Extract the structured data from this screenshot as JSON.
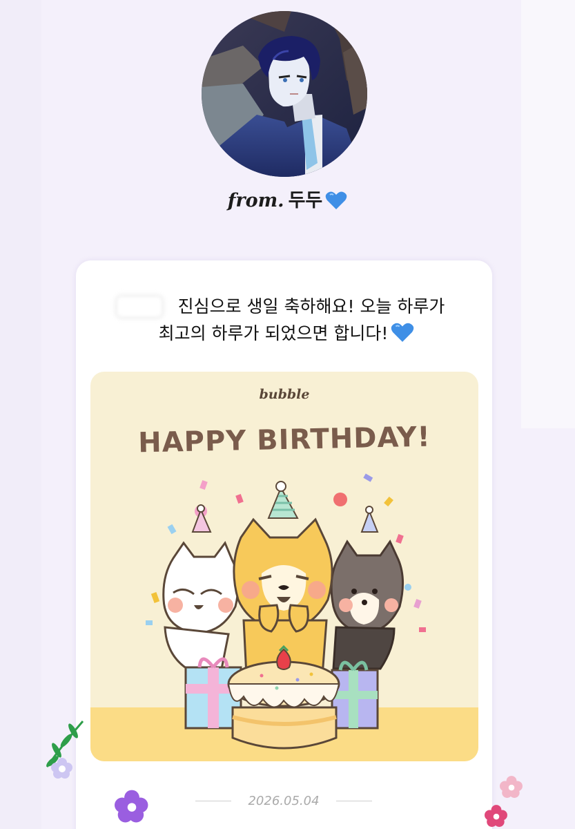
{
  "profile": {
    "from_prefix": "from.",
    "name": "두두",
    "heart_icon": "blue-heart-icon",
    "heart_color": "#3f8fe6"
  },
  "message": {
    "line1": "진심으로 생일 축하해요! 오늘 하루가",
    "line2": "최고의 하루가 되었으면 합니다!",
    "heart_icon": "blue-heart-icon"
  },
  "card_image": {
    "brand": "bubble",
    "title": "HAPPY BIRTHDAY!",
    "background_color": "#f8f0d4",
    "floor_color": "#fbdc86",
    "title_color": "#7a5c4c"
  },
  "date": "2026.05.04",
  "colors": {
    "page_background": "#f4f0fb",
    "card_background": "#ffffff"
  }
}
